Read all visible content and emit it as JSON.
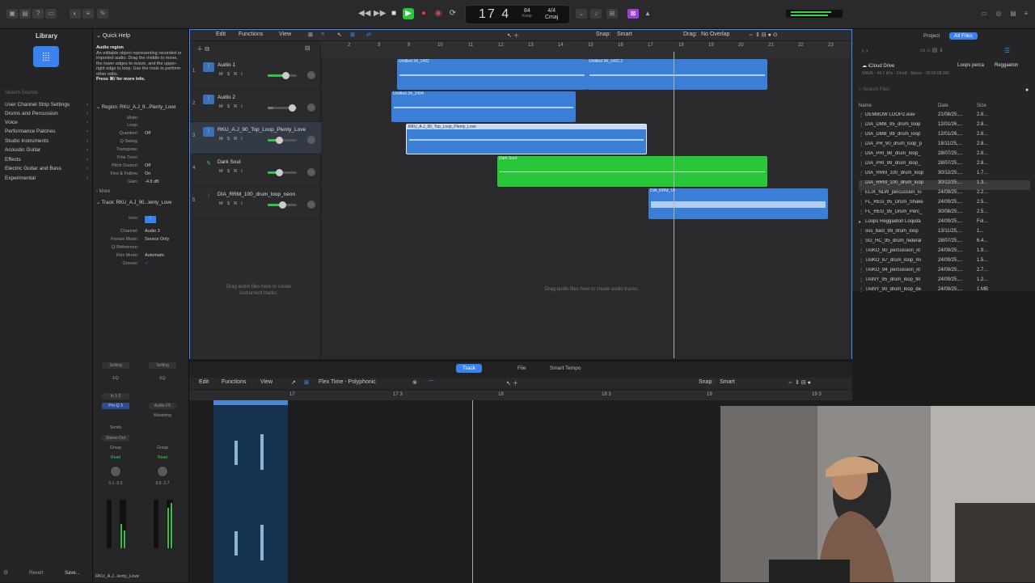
{
  "topbar": {
    "lcd_bar": "17 4",
    "tempo": "84",
    "tempo_sub": "Keep",
    "signature": "4/4",
    "key": "Cmaj"
  },
  "library": {
    "title": "Library",
    "search_placeholder": "Search Sounds",
    "items": [
      "User Channel Strip Settings",
      "Drums and Percussion",
      "Voice",
      "Performance Patches",
      "Studio Instruments",
      "Acoustic Guitar",
      "Effects",
      "Electric Guitar and Bass",
      "Experimental"
    ]
  },
  "inspector": {
    "quick_help_title": "Quick Help",
    "quick_help_heading": "Audio region",
    "quick_help_text": "An editable object representing recorded or imported audio. Drag the middle to move, the lower edges to resize, and the upper-right edge to loop. Use the tools to perform other edits.",
    "quick_help_more": "Press ⌘/ for more info.",
    "region_title": "Region: RKU_A.J_9...Plenty_Love",
    "region_rows": [
      {
        "k": "Mute:",
        "v": ""
      },
      {
        "k": "Loop:",
        "v": ""
      },
      {
        "k": "Quantize:",
        "v": "Off"
      },
      {
        "k": "Q-Swing:",
        "v": ""
      },
      {
        "k": "Transpose:",
        "v": ""
      },
      {
        "k": "Fine Tune:",
        "v": ""
      },
      {
        "k": "Pitch Source:",
        "v": "Off"
      },
      {
        "k": "Flex & Follow:",
        "v": "On"
      },
      {
        "k": "Gain:",
        "v": "-4.8 dB"
      }
    ],
    "more_label": "More",
    "track_title": "Track: RKU_A.J_90...lenty_Love",
    "track_rows": [
      {
        "k": "Icon:",
        "v": ""
      },
      {
        "k": "Channel:",
        "v": "Audio 3"
      },
      {
        "k": "Freeze Mode:",
        "v": "Source Only"
      },
      {
        "k": "Q-Reference:",
        "v": ""
      },
      {
        "k": "Flex Mode:",
        "v": "Automatic"
      },
      {
        "k": "Groove:",
        "v": ""
      }
    ]
  },
  "strips": [
    {
      "setting": "Setting",
      "eq": "EQ",
      "input": "In 1-2",
      "plugin": "Pro-Q 3",
      "sends": "Sends",
      "output": "Stereo Out",
      "group": "Group",
      "read": "Read",
      "vals": "0.1  -3.0",
      "label": "RKU_A.J...lenty_Love"
    },
    {
      "setting": "Setting",
      "eq": "EQ",
      "input": "",
      "plugin": "Audio FX",
      "sends": "Mastering",
      "output": "",
      "group": "Group",
      "read": "Read",
      "vals": "0.0  -2.7",
      "label": "Stereo Out"
    }
  ],
  "footer": {
    "revert": "Revert",
    "save": "Save..."
  },
  "arrange": {
    "menus": [
      "Edit",
      "Functions",
      "View"
    ],
    "snap_label": "Snap:",
    "snap_value": "Smart",
    "drag_label": "Drag:",
    "drag_value": "No Overlap",
    "ticks": [
      "2",
      "3",
      "9",
      "10",
      "11",
      "12",
      "13",
      "14",
      "15",
      "16",
      "17",
      "18",
      "19",
      "20",
      "21",
      "22",
      "23"
    ],
    "tracks": [
      {
        "num": "1",
        "name": "Audio 1",
        "vol": 0.6,
        "icon": "waveform-icon"
      },
      {
        "num": "2",
        "name": "Audio 2",
        "vol": 0.2,
        "icon": "waveform-icon"
      },
      {
        "num": "3",
        "name": "RKU_A.J_90_Top_Loop_Plenty_Love",
        "vol": 0.35,
        "icon": "waveform-icon"
      },
      {
        "num": "4",
        "name": "Dark Soul",
        "vol": 0.5,
        "icon": "guitar-icon"
      },
      {
        "num": "5",
        "name": "DIA_RRM_100_drum_loop_neon",
        "vol": 0.55,
        "icon": "waveform-icon"
      }
    ],
    "regions": [
      {
        "label": "Untitled 34_1#02",
        "color": "#3a7fd5"
      },
      {
        "label": "Untitled 34_1#02.2",
        "color": "#3a7fd5"
      },
      {
        "label": "Untitled 34_2#04",
        "color": "#3a7fd5"
      },
      {
        "label": "RKU_A.J_90_Top_Loop_Plenty_Love",
        "color": "#3a7fd5"
      },
      {
        "label": "Dark Soul",
        "color": "#2ac63a"
      },
      {
        "label": "DIA_RRM_10",
        "color": "#3a7fd5"
      }
    ],
    "hint_instrument": "Drag audio files here to create instrument tracks.",
    "hint_audio": "Drag audio files here to create audio tracks."
  },
  "browser": {
    "tabs": [
      "Project",
      "All Files"
    ],
    "path": "iCloud Drive",
    "path_end": "Loops perca",
    "path_end2": "Reggaeton",
    "file_meta": "WAVE · 44.1 kHz · 24-bit · Stereo · 00:00:08.000",
    "search_placeholder": "Search Files",
    "col_name": "Name",
    "col_date": "Date",
    "col_size": "Size",
    "files": [
      {
        "name": "DEMBOW LOOP2.wav",
        "date": "21/08/25,...",
        "size": "2.8..."
      },
      {
        "name": "DIA_DMB_95_drum_loop",
        "date": "12/01/26,...",
        "size": "2.8..."
      },
      {
        "name": "DIA_DMB_98_drum_loop",
        "date": "12/01/26,...",
        "size": "2.8..."
      },
      {
        "name": "DIA_PR_90_drum_loop_p",
        "date": "18/11/25,...",
        "size": "2.8..."
      },
      {
        "name": "DIA_PRI_98_drum_loop_",
        "date": "28/07/25,...",
        "size": "2.8..."
      },
      {
        "name": "DIA_PRI_99_drum_loop_",
        "date": "28/07/25,...",
        "size": "2.8..."
      },
      {
        "name": "DIA_RRM_100_drum_loop",
        "date": "30/12/25,...",
        "size": "1.7..."
      },
      {
        "name": "DIA_RRM_100_drum_loop",
        "date": "30/12/25,...",
        "size": "1.3..."
      },
      {
        "name": "ELIX_NLW_percussion_lo",
        "date": "24/09/25,...",
        "size": "2.2..."
      },
      {
        "name": "FL_REG_95_Drum_Shake",
        "date": "24/09/25,...",
        "size": "2.5..."
      },
      {
        "name": "FL_REG_95_Drum_Perc_",
        "date": "30/08/25,...",
        "size": "2.5..."
      },
      {
        "name": "Loops Reggaeton Loquita",
        "date": "24/09/25,...",
        "size": "Fol..."
      },
      {
        "name": "oss_bast_99_drum_loop",
        "date": "13/11/25,...",
        "size": "1..."
      },
      {
        "name": "SG_HC_95_drum_federal",
        "date": "28/07/25,...",
        "size": "6.4..."
      },
      {
        "name": "TAIKO_80_percussion_lo",
        "date": "24/09/25,...",
        "size": "1.9..."
      },
      {
        "name": "TAIKO_87_drum_loop_mi",
        "date": "24/09/25,...",
        "size": "1.5..."
      },
      {
        "name": "TAIKO_94_percussion_lo",
        "date": "24/09/25,...",
        "size": "2.7..."
      },
      {
        "name": "TAINY_95_drum_loop_fill",
        "date": "24/09/25,...",
        "size": "1.2..."
      },
      {
        "name": "TAINY_90_drum_loop_de",
        "date": "24/09/25,...",
        "size": "1 MB"
      }
    ]
  },
  "editor": {
    "tabs": [
      "Track",
      "File",
      "Smart Tempo"
    ],
    "menus": [
      "Edit",
      "Functions",
      "View"
    ],
    "flex_mode": "Flex Time - Polyphonic",
    "snap_label": "Snap:",
    "snap_value": "Smart",
    "ruler": [
      "17",
      "17 3",
      "18",
      "18 3",
      "19",
      "19 3"
    ]
  }
}
